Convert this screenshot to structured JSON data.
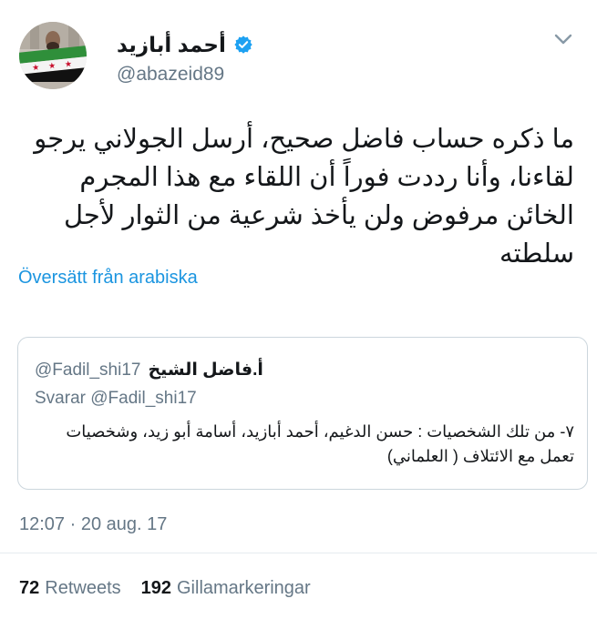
{
  "author": {
    "display_name": "أحمد أبازيد",
    "handle": "@abazeid89",
    "verified": true
  },
  "tweet": {
    "text": "ما ذكره حساب فاضل صحيح، أرسل الجولاني يرجو لقاءنا، وأنا رددت فوراً أن اللقاء مع هذا المجرم الخائن مرفوض ولن يأخذ شرعية من الثوار لأجل سلطته",
    "translate_label": "Översätt från arabiska",
    "timestamp": "12:07 · 20 aug. 17"
  },
  "quoted_tweet": {
    "display_name": "أ.فاضل الشيخ",
    "handle": "@Fadil_shi17",
    "reply_prefix": "Svarar",
    "reply_to": "@Fadil_shi17",
    "text": "٧- من تلك الشخصيات : حسن الدغيم، أحمد أبازيد، أسامة أبو زيد، وشخصيات تعمل مع الائتلاف ( العلماني)"
  },
  "stats": {
    "retweets_count": "72",
    "retweets_label": "Retweets",
    "likes_count": "192",
    "likes_label": "Gillamarkeringar"
  },
  "colors": {
    "link": "#1b95e0",
    "muted": "#657786",
    "border": "#ccd6dd"
  },
  "icons": {
    "verified": "verified-badge-icon",
    "menu": "chevron-down-icon"
  }
}
